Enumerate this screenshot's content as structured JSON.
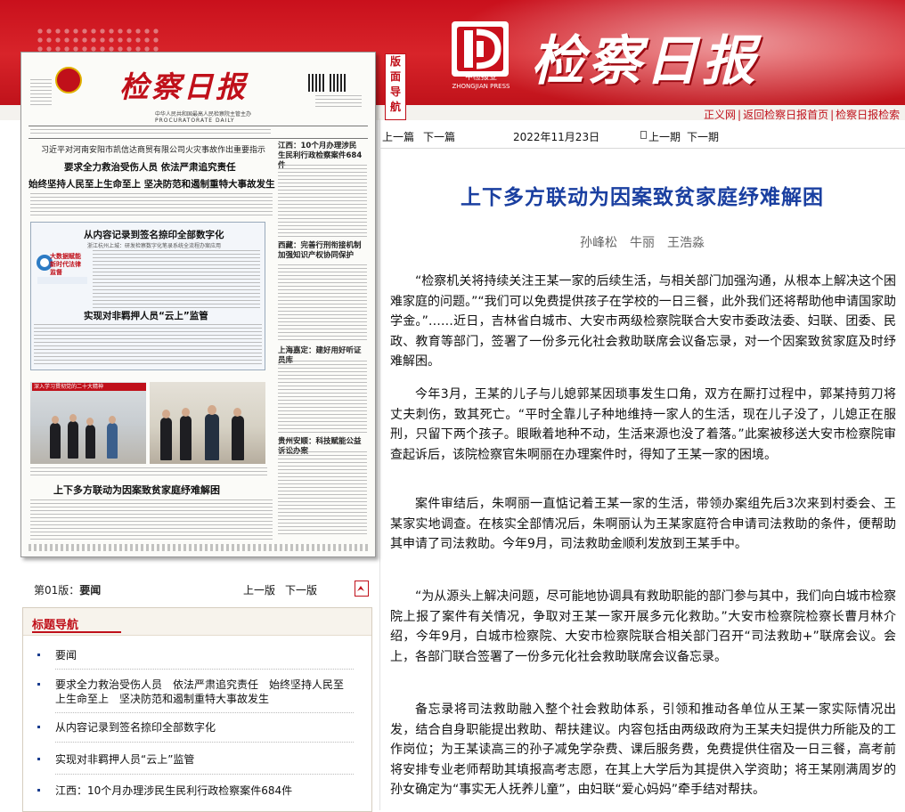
{
  "header": {
    "brand_title": "检察日报",
    "logo_caption_cn": "中检报业",
    "logo_caption_en": "ZHONGJIAN PRESS",
    "nav_vertical": [
      "版",
      "面",
      "导",
      "航"
    ],
    "links": [
      "正义网",
      "返回检察日报首页",
      "检察日报检索"
    ]
  },
  "paper_thumbnail": {
    "masthead": "检察日报",
    "masthead_sub": "中华人民共和国最高人民检察院主管主办",
    "masthead_en": "PROCURATORATE DAILY",
    "top_line": "习近平对河南安阳市凯信达商贸有限公司火灾事故作出重要指示",
    "headline_1": "要求全力救治受伤人员  依法严肃追究责任",
    "headline_2": "始终坚持人民至上生命至上  坚决防范和遏制重特大事故发生",
    "right_1": "江西：10个月办理涉民生民利行政检察案件684件",
    "right_2": "西藏：完善行刑衔接机制加强知识产权协同保护",
    "right_3": "上海嘉定：建好用好听证员库",
    "right_4": "贵州安顺：科技赋能公益诉讼办案",
    "box_title": "从内容记录到签名捺印全部数字化",
    "box_sub": "浙江杭州上城：研发检察数字化笔录系统全流程办案应用",
    "ad_text": "大数据赋能新时代法律监督",
    "box_title_2": "实现对非羁押人员“云上”监管",
    "photo_caption": "深入学习贯彻党的二十大精神",
    "bottom_headline": "上下多方联动为因案致贫家庭纾难解困"
  },
  "edition": {
    "label": "第01版：",
    "name": "要闻",
    "prev": "上一版",
    "next": "下一版",
    "pdf_icon": "pdf-icon"
  },
  "toc": {
    "title": "标题导航",
    "items": [
      "要闻",
      "要求全力救治受伤人员　依法严肃追究责任　始终坚持人民至上生命至上　坚决防范和遏制重特大事故发生",
      "从内容记录到签名捺印全部数字化",
      "实现对非羁押人员“云上”监管",
      "江西：10个月办理涉民生民利行政检察案件684件"
    ]
  },
  "issue_bar": {
    "prev_article": "上一篇",
    "next_article": "下一篇",
    "date": "2022年11月23日",
    "prev_issue": "上一期",
    "next_issue": "下一期"
  },
  "article": {
    "title": "上下多方联动为因案致贫家庭纾难解困",
    "authors": "孙峰松　牛丽　王浩淼",
    "paragraphs": [
      "“检察机关将持续关注王某一家的后续生活，与相关部门加强沟通，从根本上解决这个困难家庭的问题。”“我们可以免费提供孩子在学校的一日三餐，此外我们还将帮助他申请国家助学金。”……近日，吉林省白城市、大安市两级检察院联合大安市委政法委、妇联、团委、民政、教育等部门，签署了一份多元化社会救助联席会议备忘录，对一个因案致贫家庭及时纾难解困。",
      "今年3月，王某的儿子与儿媳郭某因琐事发生口角，双方在厮打过程中，郭某持剪刀将丈夫刺伤，致其死亡。“平时全靠儿子种地维持一家人的生活，现在儿子没了，儿媳正在服刑，只留下两个孩子。眼瞅着地种不动，生活来源也没了着落。”此案被移送大安市检察院审查起诉后，该院检察官朱啊丽在办理案件时，得知了王某一家的困境。",
      "案件审结后，朱啊丽一直惦记着王某一家的生活，带领办案组先后3次来到村委会、王某家实地调查。在核实全部情况后，朱啊丽认为王某家庭符合申请司法救助的条件，便帮助其申请了司法救助。今年9月，司法救助金顺利发放到王某手中。",
      "“为从源头上解决问题，尽可能地协调具有救助职能的部门参与其中，我们向白城市检察院上报了案件有关情况，争取对王某一家开展多元化救助。”大安市检察院检察长曹月林介绍，今年9月，白城市检察院、大安市检察院联合相关部门召开“司法救助+”联席会议。会上，各部门联合签署了一份多元化社会救助联席会议备忘录。",
      "备忘录将司法救助融入整个社会救助体系，引领和推动各单位从王某一家实际情况出发，结合自身职能提出救助、帮扶建议。内容包括由两级政府为王某夫妇提供力所能及的工作岗位；为王某读高三的孙子减免学杂费、课后服务费，免费提供住宿及一日三餐，高考前将安排专业老师帮助其填报高考志愿，在其上大学后为其提供入学资助；将王某刚满周岁的孙女确定为“事实无人抚养儿童”，由妇联“爱心妈妈”牵手结对帮扶。"
    ]
  },
  "colors": {
    "brand_red": "#c9101c",
    "title_blue": "#1a3fa0"
  }
}
